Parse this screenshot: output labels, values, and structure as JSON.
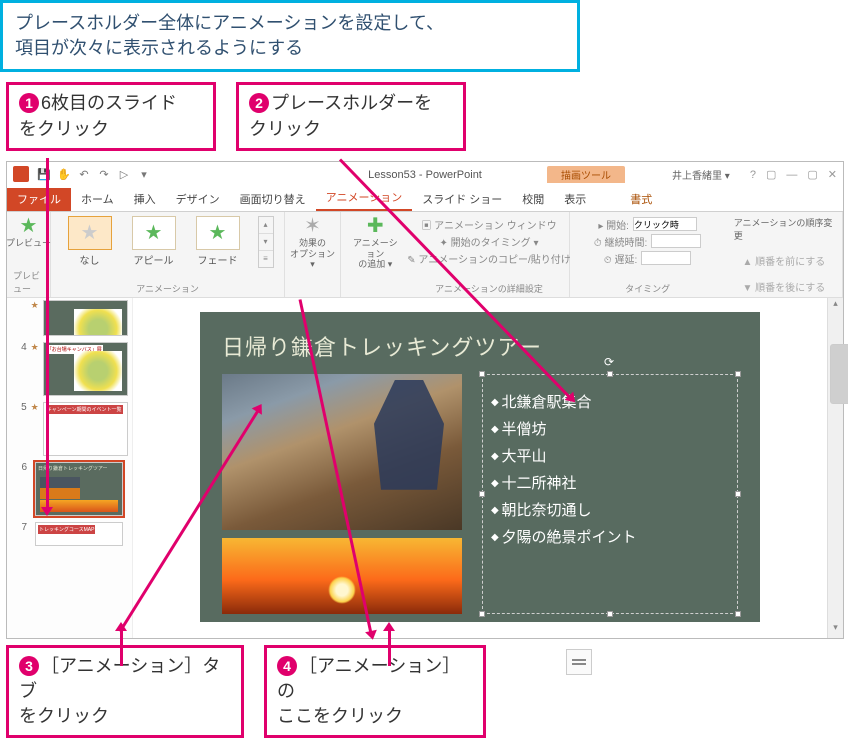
{
  "banner": {
    "line1": "プレースホルダー全体にアニメーションを設定して、",
    "line2": "項目が次々に表示されるようにする"
  },
  "callouts": {
    "c1": {
      "num": "1",
      "text_a": "6枚目のスライド",
      "text_b": "をクリック"
    },
    "c2": {
      "num": "2",
      "text_a": "プレースホルダーを",
      "text_b": "クリック"
    },
    "c3": {
      "num": "3",
      "text_a": "［アニメーション］タブ",
      "text_b": "をクリック"
    },
    "c4": {
      "num": "4",
      "text_a": "［アニメーション］の",
      "text_b": "ここをクリック"
    }
  },
  "titlebar": {
    "doc_title": "Lesson53 - PowerPoint",
    "context_tab": "描画ツール",
    "user": "井上香緒里 ▾"
  },
  "qat": {
    "save": "💾",
    "touch": "✋",
    "undo": "↶",
    "redo": "↷",
    "start": "▷",
    "more": "▾"
  },
  "win_controls": {
    "help": "?",
    "ribbon": "▢",
    "min": "—",
    "max": "▢",
    "close": "✕"
  },
  "tabs": {
    "file": "ファイル",
    "home": "ホーム",
    "insert": "挿入",
    "design": "デザイン",
    "transitions": "画面切り替え",
    "animations": "アニメーション",
    "slideshow": "スライド ショー",
    "review": "校閲",
    "view": "表示",
    "format": "書式"
  },
  "ribbon": {
    "preview_btn": "プレビュー",
    "preview_group": "プレビュー",
    "anim_none": "なし",
    "anim_appear": "アピール",
    "anim_fade": "フェード",
    "anim_group": "アニメーション",
    "effect_opts": "効果の\nオプション ▾",
    "add_anim": "アニメーション\nの追加 ▾",
    "adv_pane": "▣ アニメーション ウィンドウ",
    "adv_trigger": "✦ 開始のタイミング ▾",
    "adv_painter": "✎ アニメーションのコピー/貼り付け",
    "adv_group": "アニメーションの詳細設定",
    "t_start_lbl": "▸ 開始:",
    "t_start_val": "クリック時",
    "t_dur_lbl": "⏱ 継続時間:",
    "t_dur_val": "",
    "t_delay_lbl": "⏲ 遅延:",
    "t_delay_val": "",
    "timing_group": "タイミング",
    "order_hdr": "アニメーションの順序変更",
    "order_up": "▲ 順番を前にする",
    "order_dn": "▼ 順番を後にする"
  },
  "thumbs": {
    "slide3_num": "",
    "slide4_num": "4",
    "slide4_title": "「お台場キャンバス」展",
    "slide5_num": "5",
    "slide5_title": "キャンペーン期間のイベント一覧",
    "slide6_num": "6",
    "slide6_title": "日帰り鎌倉トレッキングツアー",
    "slide7_num": "7",
    "slide7_title": "トレッキングコースMAP"
  },
  "slide": {
    "title": "日帰り鎌倉トレッキングツアー",
    "bullets": {
      "b1": "北鎌倉駅集合",
      "b2": "半僧坊",
      "b3": "大平山",
      "b4": "十二所神社",
      "b5": "朝比奈切通し",
      "b6": "夕陽の絶景ポイント"
    },
    "rotate": "⟳"
  }
}
